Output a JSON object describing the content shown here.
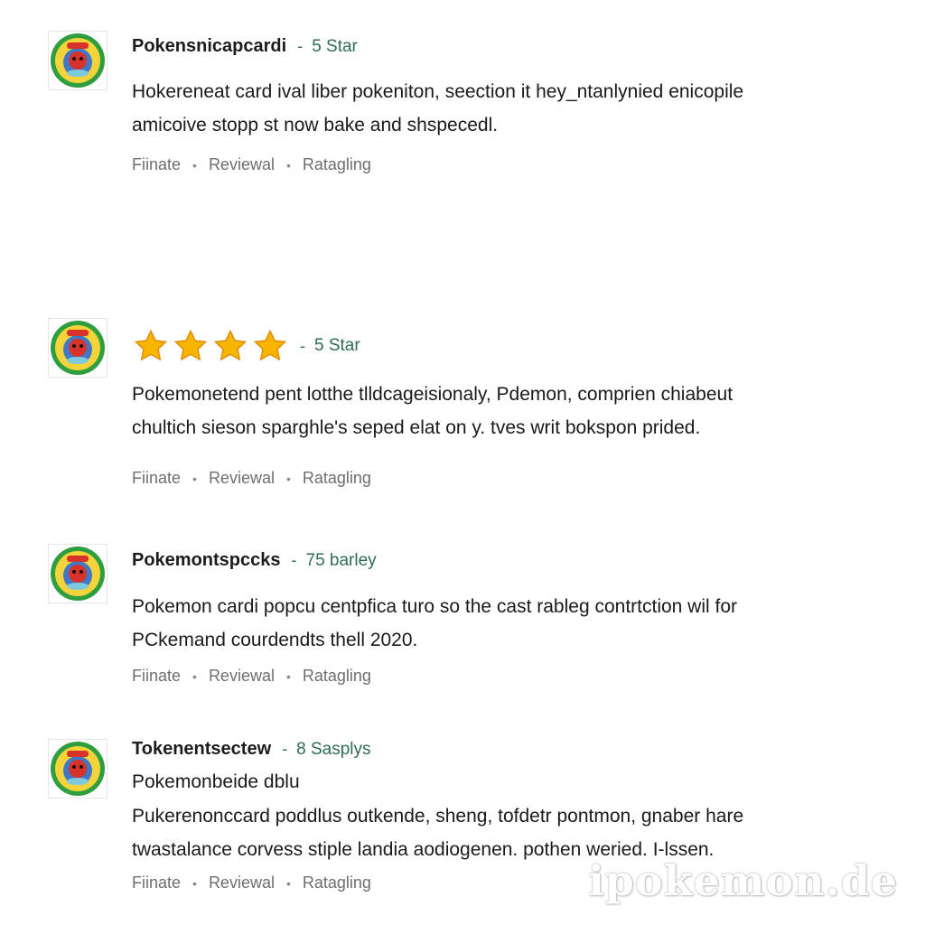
{
  "reviews": [
    {
      "username": "Pokensnicapcardi",
      "separator": "-",
      "rating_label": "5 Star",
      "stars_shown": 0,
      "title": "",
      "body_lines": [
        "Hokereneat card ival liber pokeniton, seection it hey_ntanlynied enicopile",
        "amicoive stopp st now bake and shspecedl."
      ],
      "meta": [
        "Fiinate",
        "Reviewal",
        "Ratagling"
      ]
    },
    {
      "username": "",
      "separator": "-",
      "rating_label": "5 Star",
      "stars_shown": 4,
      "title": "",
      "body_lines": [
        "Pokemonetend pent lotthe tlldcageisionaly, Pdemon, comprien chiabeut",
        "chultich sieson sparghle's seped elat on y. tves writ bokspon prided."
      ],
      "meta": [
        "Fiinate",
        "Reviewal",
        "Ratagling"
      ]
    },
    {
      "username": "Pokemontspccks",
      "separator": "-",
      "rating_label": "75 barley",
      "stars_shown": 0,
      "title": "",
      "body_lines": [
        "Pokemon cardi popcu centpfica turo so the cast rableg contrtction wil for",
        "PCkemand courdendts thell 2020."
      ],
      "meta": [
        "Fiinate",
        "Reviewal",
        "Ratagling"
      ]
    },
    {
      "username": "Tokenentsectew",
      "separator": "-",
      "rating_label": "8 Sasplys",
      "stars_shown": 0,
      "title": "Pokemonbeide dblu",
      "body_lines": [
        "Pukerenonccard poddlus outkende, sheng, tofdetr pontmon, gnaber hare",
        "twastalance corvess stiple landia aodiogenen. pothen weried. I-lssen."
      ],
      "meta": [
        "Fiinate",
        "Reviewal",
        "Ratagling"
      ]
    }
  ],
  "watermark": "ipokemon.de",
  "colors": {
    "rating_text": "#2f6b5a",
    "meta_text": "#6e6e6e",
    "star_fill": "#f7b500",
    "avatar_ring": "#2e9e3e"
  },
  "icons": {
    "avatar": "pokemon-badge-avatar",
    "star": "star-icon"
  }
}
